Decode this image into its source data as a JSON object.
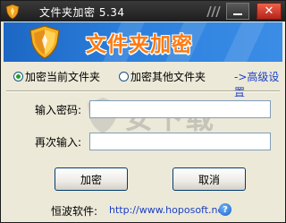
{
  "window": {
    "title": "文件夹加密 5.34",
    "minimize_icon": "minimize-icon",
    "close_symbol": "✕"
  },
  "banner": {
    "title": "文件夹加密",
    "icon": "shield-icon",
    "colors": {
      "background": "#2b7fdc",
      "title": "#ff7a10"
    }
  },
  "mode": {
    "options": [
      {
        "label": "加密当前文件夹",
        "selected": true
      },
      {
        "label": "加密其他文件夹",
        "selected": false
      }
    ],
    "advanced_label": "->高级设置"
  },
  "form": {
    "password_label": "输入密码:",
    "password_value": "",
    "confirm_label": "再次输入:",
    "confirm_value": ""
  },
  "watermark": {
    "main_text": "安下载",
    "sub_text": "anxz.com"
  },
  "buttons": {
    "encrypt_label": "加密",
    "cancel_label": "取消"
  },
  "footer": {
    "label": "恒波软件:",
    "url": "http://www.hoposoft.net",
    "help_icon_text": "?"
  }
}
